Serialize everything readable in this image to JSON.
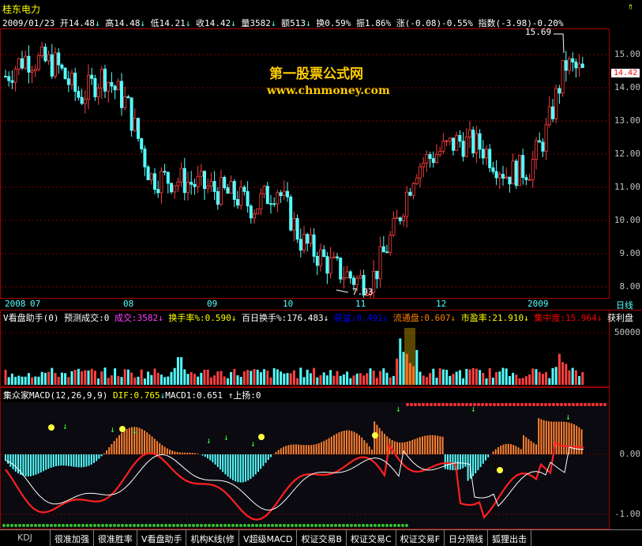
{
  "title": "桂东电力",
  "quote_line": {
    "date": "2009/01/23",
    "open": "开14.48",
    "high": "高14.48",
    "low": "低14.21",
    "close": "收14.42",
    "volume": "量3582",
    "amount": "额513",
    "turnover": "换0.59%",
    "amplitude": "振1.86%",
    "change": "涨(-0.08)-0.55%",
    "index": "指数(-3.98)-0.20%"
  },
  "watermark": {
    "line1": "第一股票公式网",
    "line2": "www.chnmoney.com"
  },
  "price_axis": {
    "ticks": [
      "15.00",
      "14.00",
      "13.00",
      "12.00",
      "11.00",
      "10.00",
      "9.00",
      "8.00"
    ],
    "current": "14.42",
    "high_label": "15.69",
    "low_label": "7.93"
  },
  "time_axis": {
    "labels": [
      "2008",
      "07",
      "08",
      "09",
      "10",
      "11",
      "12",
      "2009"
    ],
    "period": "日线"
  },
  "volume_panel": {
    "header": "V看盘助手(0) 预测成交:0",
    "items": [
      {
        "label": "成交:3582",
        "color": "#ff40ff"
      },
      {
        "label": "换手率%:0.590",
        "color": "#ffff00"
      },
      {
        "label": "百日换手%:176.483",
        "color": "#ffffff"
      },
      {
        "label": "获益:0.491",
        "color": "#0000ff"
      },
      {
        "label": "流通盘:0.607",
        "color": "#ff8000"
      },
      {
        "label": "市盈率:21.910",
        "color": "#ffff00"
      },
      {
        "label": "集中度:15.964",
        "color": "#ff0000"
      },
      {
        "label": "获利盘",
        "color": "#ffffff"
      }
    ],
    "tick": "50000"
  },
  "macd_panel": {
    "header": "集众家MACD(12,26,9,9)",
    "dif": "DIF:0.765",
    "macd1": "MACD1:0.651",
    "rise": "上扬:0",
    "ticks": [
      "0.00",
      "-1.00"
    ]
  },
  "tabs": [
    "KDJ",
    "很准加强",
    "很准胜率",
    "V看盘助手",
    "机构K线(修",
    "V超级MACD",
    "权证交易B",
    "权证交易C",
    "权证交易F",
    "日分隔线",
    "狐狸出击"
  ],
  "colors": {
    "up": "#ff4040",
    "down": "#54ffff",
    "frame": "#a00000",
    "grid": "#800000"
  }
}
